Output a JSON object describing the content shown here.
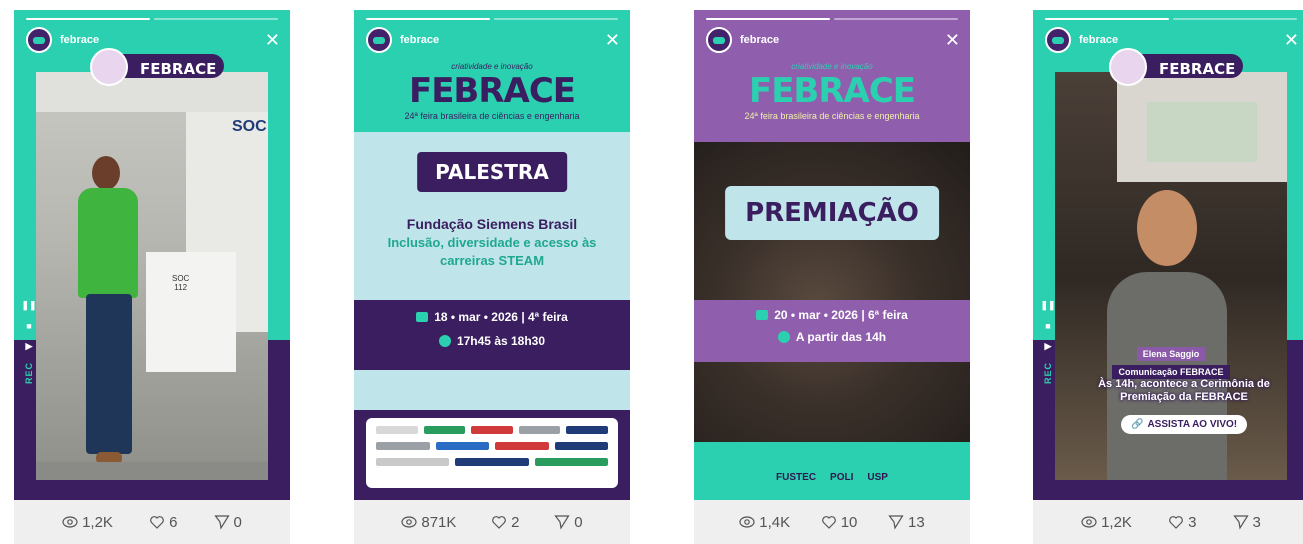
{
  "stories": [
    {
      "username": "febrace",
      "badge_text": "FEBRACE",
      "booth_sign": "SOC",
      "booth_number": "SOC\n112",
      "rec_label": "REC",
      "stats": {
        "views": "1,2K",
        "likes": "6",
        "shares": "0"
      }
    },
    {
      "username": "febrace",
      "logo_tagline": "criatividade e inovação",
      "logo_brand": "FEBRACE",
      "logo_edition": "24ª feira brasileira de ciências e engenharia",
      "banner": "PALESTRA",
      "headline": "Fundação Siemens Brasil",
      "subtitle": "Inclusão, diversidade e acesso às carreiras STEAM",
      "date": "18 • mar • 2026 | 4ª feira",
      "time": "17h45 às 18h30",
      "stats": {
        "views": "871K",
        "likes": "2",
        "shares": "0"
      }
    },
    {
      "username": "febrace",
      "logo_tagline": "criatividade e inovação",
      "logo_brand": "FEBRACE",
      "logo_edition": "24ª feira brasileira de ciências e engenharia",
      "banner": "PREMIAÇÃO",
      "date": "20 • mar • 2026 | 6ª feira",
      "time": "A partir das 14h",
      "footer_logos": [
        "FUSTEC",
        "POLI",
        "USP"
      ],
      "stats": {
        "views": "1,4K",
        "likes": "10",
        "shares": "13"
      }
    },
    {
      "username": "febrace",
      "badge_text": "FEBRACE",
      "rec_label": "REC",
      "speaker_name": "Elena Saggio",
      "speaker_role": "Comunicação FEBRACE",
      "caption": "Às 14h, acontece a Cerimônia de Premiação da FEBRACE",
      "cta": "ASSISTA AO VIVO!",
      "stats": {
        "views": "1,2K",
        "likes": "3",
        "shares": "3"
      }
    }
  ],
  "colors": {
    "purple": "#3a1e5f",
    "teal": "#2bd0b0",
    "light_blue": "#bfe4ea",
    "stats_bg": "#efefef"
  },
  "icons": [
    "eye-icon",
    "heart-icon",
    "send-icon",
    "close-icon",
    "pause-icon",
    "stop-icon",
    "play-icon"
  ]
}
